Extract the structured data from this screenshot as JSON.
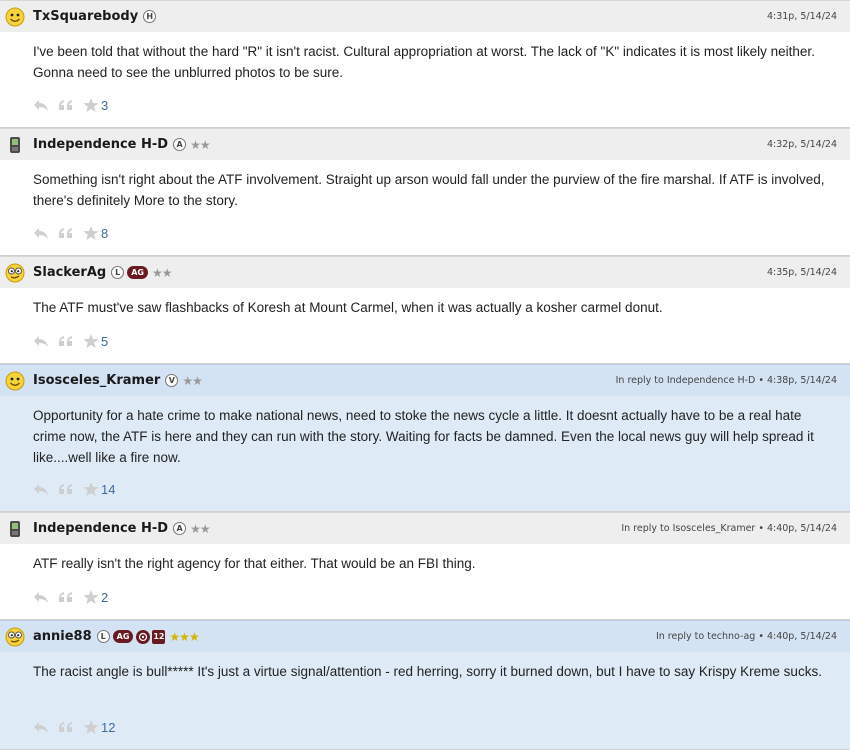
{
  "posts": [
    {
      "username": "TxSquarebody",
      "avatar": "smiley-face-icon",
      "badges": [
        "H"
      ],
      "ag": "",
      "extra_icons": false,
      "stars": "",
      "stars_gold": false,
      "meta": "4:31p, 5/14/24",
      "body": "I've been told that without the hard \"R\" it isn't racist. Cultural appropriation at worst. The lack of \"K\" indicates it is most likely neither. Gonna need to see the unblurred photos to be sure.",
      "count": "3",
      "highlight": false
    },
    {
      "username": "Independence H-D",
      "avatar": "phone-icon",
      "badges": [
        "A"
      ],
      "ag": "",
      "extra_icons": false,
      "stars": "★★",
      "stars_gold": false,
      "meta": "4:32p, 5/14/24",
      "body": "Something isn't right about the ATF involvement. Straight up arson would fall under the purview of the fire marshal. If ATF is involved, there's definitely More to the story.",
      "count": "8",
      "highlight": false
    },
    {
      "username": "SlackerAg",
      "avatar": "nerd-face-icon",
      "badges": [
        "L"
      ],
      "ag": "AG",
      "extra_icons": false,
      "stars": "★★",
      "stars_gold": false,
      "meta": "4:35p, 5/14/24",
      "body": "The ATF must've saw flashbacks of Koresh at Mount Carmel, when it was actually a kosher carmel donut.",
      "count": "5",
      "highlight": false
    },
    {
      "username": "Isosceles_Kramer",
      "avatar": "smiley-face-icon",
      "badges": [
        "V"
      ],
      "ag": "",
      "extra_icons": false,
      "stars": "★★",
      "stars_gold": false,
      "meta": "In reply to Independence H-D • 4:38p, 5/14/24",
      "body": "Opportunity for a hate crime to make national news, need to stoke the news cycle a little. It doesnt actually have to be a real hate crime now, the ATF is here and they can run with the story. Waiting for facts be damned. Even the local news guy will help spread it like....well like a fire now.",
      "count": "14",
      "highlight": true
    },
    {
      "username": "Independence H-D",
      "avatar": "phone-icon",
      "badges": [
        "A"
      ],
      "ag": "",
      "extra_icons": false,
      "stars": "★★",
      "stars_gold": false,
      "meta": "In reply to Isosceles_Kramer • 4:40p, 5/14/24",
      "body": "ATF really isn't the right agency for that either. That would be an FBI thing.",
      "count": "2",
      "highlight": false
    },
    {
      "username": "annie88",
      "avatar": "nerd-face-icon",
      "badges": [
        "L"
      ],
      "ag": "AG",
      "extra_icons": true,
      "num_badge": "12",
      "stars": "★★★",
      "stars_gold": true,
      "meta": "In reply to techno-ag • 4:40p, 5/14/24",
      "body": "The racist angle is bull***** It's just a virtue signal/attention - red herring, sorry it burned down, but I have to say Krispy Kreme sucks.",
      "count": "12",
      "highlight": true
    }
  ]
}
